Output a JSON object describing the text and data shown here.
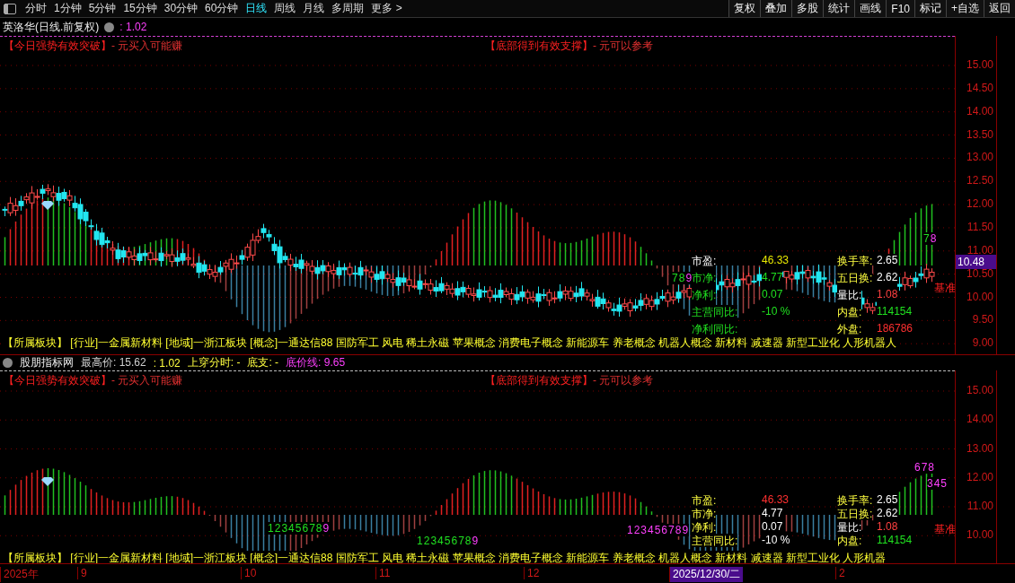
{
  "toolbar": {
    "periods": [
      {
        "label": "分时",
        "selected": false
      },
      {
        "label": "1分钟",
        "selected": false
      },
      {
        "label": "5分钟",
        "selected": false
      },
      {
        "label": "15分钟",
        "selected": false
      },
      {
        "label": "30分钟",
        "selected": false
      },
      {
        "label": "60分钟",
        "selected": false
      },
      {
        "label": "日线",
        "selected": true
      },
      {
        "label": "周线",
        "selected": false
      },
      {
        "label": "月线",
        "selected": false
      },
      {
        "label": "多周期",
        "selected": false
      },
      {
        "label": "更多 >",
        "selected": false
      }
    ],
    "buttons": [
      "复权",
      "叠加",
      "多股",
      "统计",
      "画线",
      "F10",
      "标记",
      "+自选",
      "返回"
    ]
  },
  "main_pane": {
    "title": "英洛华(日线.前复权)",
    "value": ": 1.02",
    "signals": [
      {
        "label": "【今日强势有效突破】",
        "note": "- 元买入可能赚"
      },
      {
        "label": "【底部得到有效支撑】",
        "note": "- 元可以参考"
      }
    ],
    "axis": [
      "15.00",
      "14.50",
      "14.00",
      "13.50",
      "13.00",
      "12.50",
      "12.00",
      "11.50",
      "11.00",
      "10.50",
      "10.00",
      "9.50",
      "9.00"
    ],
    "current_price": "10.48",
    "baseline": "基准",
    "counters": [
      {
        "text": "789",
        "kind": "rise"
      },
      {
        "text": "78",
        "kind": "rise"
      }
    ],
    "info_left": [
      {
        "label": "市盈:",
        "value": "46.33"
      },
      {
        "label": "市净:",
        "value": "4.77"
      },
      {
        "label": "净利:",
        "value": "0.07"
      },
      {
        "label": "主营同比:",
        "value": "-10 %"
      },
      {
        "label": "净利同比:"
      }
    ],
    "info_right": [
      {
        "label": "换手率:",
        "value": "2.65"
      },
      {
        "label": "五日换:",
        "value": "2.62"
      },
      {
        "label": "量比:",
        "value": "1.08"
      },
      {
        "label": "内盘:",
        "value": "114154"
      },
      {
        "label": "外盘:",
        "value": "186786"
      }
    ],
    "sectors": "【所属板块】 [行业]一金属新材料 [地域]一浙江板块 [概念]一通达信88 国防军工 风电 稀土永磁 苹果概念 消费电子概念 新能源车 养老概念 机器人概念 新材料 减速器 新型工业化 人形机器人"
  },
  "sub_pane": {
    "name": "股朋指标网",
    "stats": [
      {
        "text": "最高价: 15.62",
        "kind": "stat"
      },
      {
        "text": ": 1.02",
        "kind": "signal"
      },
      {
        "text": "上穿分时: -",
        "kind": "signal"
      },
      {
        "text": "底支: -",
        "kind": "signal"
      },
      {
        "text": "底价线: 9.65",
        "kind": "line"
      }
    ],
    "signals": [
      {
        "label": "【今日强势有效突破】",
        "note": "- 元买入可能赚"
      },
      {
        "label": "【底部得到有效支撑】",
        "note": "- 元可以参考"
      }
    ],
    "axis": [
      "15.00",
      "14.00",
      "13.00",
      "12.00",
      "11.00",
      "10.00"
    ],
    "baseline": "基准",
    "counters": [
      {
        "text": "123456789",
        "kind": "rise"
      },
      {
        "text": "123456789",
        "kind": "rise"
      },
      {
        "text": "123456789",
        "kind": "fall"
      },
      {
        "text": "345",
        "kind": "fall"
      },
      {
        "text": "678",
        "kind": "fall"
      }
    ],
    "info_left": [
      {
        "label": "市盈:",
        "value": "46.33"
      },
      {
        "label": "市净:",
        "value": "4.77"
      },
      {
        "label": "净利:",
        "value": "0.07"
      },
      {
        "label": "主营同比:",
        "value": "-10 %"
      }
    ],
    "info_right": [
      {
        "label": "换手率:",
        "value": "2.65"
      },
      {
        "label": "五日换:",
        "value": "2.62"
      },
      {
        "label": "量比:",
        "value": "1.08"
      },
      {
        "label": "内盘:",
        "value": "114154"
      }
    ],
    "sectors": "【所属板块】 [行业]一金属新材料 [地域]一浙江板块 [概念]一通达信88 国防军工 风电 稀土永磁 苹果概念 消费电子概念 新能源车 养老概念 机器人概念 新材料 减速器 新型工业化 人形机器"
  },
  "date_axis": [
    {
      "label": "2025年",
      "selected": false
    },
    {
      "label": "9",
      "selected": false
    },
    {
      "label": "10",
      "selected": false
    },
    {
      "label": "11",
      "selected": false
    },
    {
      "label": "12",
      "selected": false
    },
    {
      "label": "2025/12/30/二",
      "selected": true
    },
    {
      "label": "2",
      "selected": false
    }
  ]
}
